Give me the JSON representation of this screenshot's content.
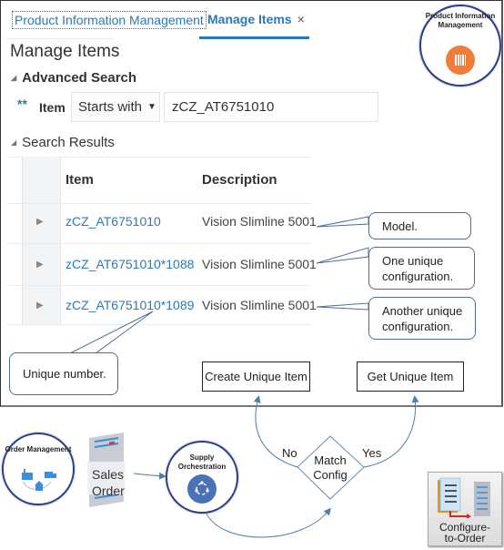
{
  "tabs": {
    "pim_label": "Product Information Management",
    "active_label": "Manage Items",
    "close_glyph": "×"
  },
  "page_title": "Manage Items",
  "advanced_search": {
    "header": "Advanced Search",
    "required_marker": "**",
    "field_label": "Item",
    "operator": "Starts with",
    "operator_arrow": "▼",
    "value": "zCZ_AT6751010"
  },
  "search_results": {
    "header": "Search Results",
    "columns": [
      "Item",
      "Description"
    ],
    "rows": [
      {
        "item": "zCZ_AT6751010",
        "description": "Vision Slimline 5001"
      },
      {
        "item": "zCZ_AT6751010*1088",
        "description": "Vision Slimline 5001"
      },
      {
        "item": "zCZ_AT6751010*1089",
        "description": "Vision Slimline 5001"
      }
    ],
    "expander_glyph": "▶",
    "section_glyph": "◢"
  },
  "callouts": {
    "model": "Model.",
    "one_unique": "One unique configuration.",
    "another_unique": "Another unique configuration.",
    "unique_number": "Unique number."
  },
  "badges": {
    "pim": "Product Information Management",
    "order_management": "Order Management",
    "supply_orchestration": "Supply Orchestration",
    "configure_to_order": "Configure-to-Order"
  },
  "flow": {
    "sales_order": "Sales Order",
    "decision": "Match Config",
    "no_label": "No",
    "yes_label": "Yes",
    "create_unique_item": "Create Unique Item",
    "get_unique_item": "Get Unique Item"
  },
  "colors": {
    "link": "#2a7ab8",
    "callout_border": "#4a6f93",
    "badge_ring": "#2a3f8f",
    "pim_orange": "#ee7d3b",
    "supply_blue": "#4a72b8",
    "arrow": "#4f7ea8"
  }
}
